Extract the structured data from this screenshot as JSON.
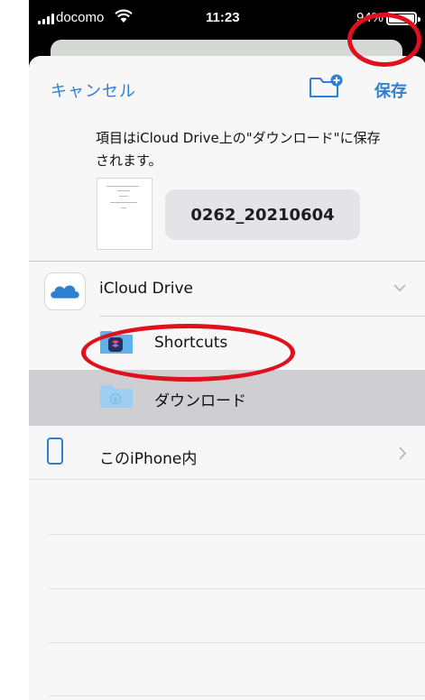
{
  "status_bar": {
    "carrier": "docomo",
    "time": "11:23",
    "battery": "94%"
  },
  "nav": {
    "cancel_label": "キャンセル",
    "save_label": "保存",
    "new_folder_icon": "folder-plus-icon"
  },
  "description": "項目はiCloud Drive上の\"ダウンロード\"に保存されます。",
  "file": {
    "name": "0262_20210604"
  },
  "locations": {
    "icloud": {
      "label": "iCloud Drive",
      "icon": "cloud-icon",
      "expanded": true
    },
    "shortcuts": {
      "label": "Shortcuts",
      "icon": "shortcuts-folder-icon"
    },
    "downloads": {
      "label": "ダウンロード",
      "icon": "download-folder-icon",
      "selected": true
    },
    "on_iphone": {
      "label": "このiPhone内",
      "icon": "iphone-icon"
    }
  },
  "colors": {
    "accent": "#2f7fd3",
    "annotation": "#e0111c",
    "selected_row": "#cfcfd3"
  }
}
